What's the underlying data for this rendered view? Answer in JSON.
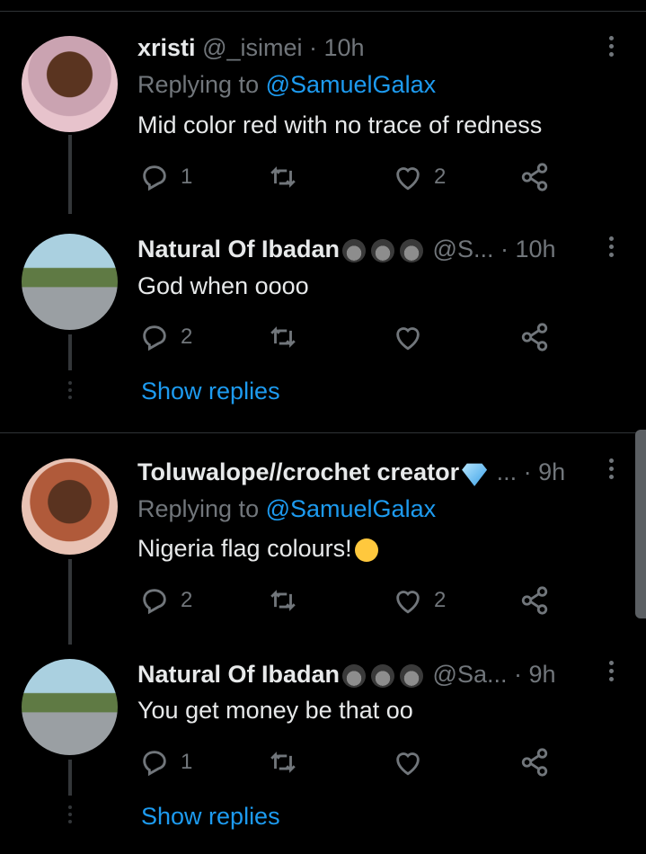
{
  "tweets": [
    {
      "name": "xristi",
      "handle": "@_isimei",
      "dot": " · ",
      "time": "10h",
      "replying_label": "Replying to ",
      "replying_mention": "@SamuelGalax",
      "text": "Mid color red with no trace of redness",
      "reply_count": "1",
      "retweet_count": "",
      "like_count": "2"
    },
    {
      "name": "Natural Of Ibadan",
      "handle": "@S...",
      "dot": " · ",
      "time": "10h",
      "text": "God when oooo",
      "reply_count": "2",
      "retweet_count": "",
      "like_count": "",
      "show_replies": "Show replies"
    },
    {
      "name": "Toluwalope//crochet creator",
      "handle": "...",
      "dot": " · ",
      "time": "9h",
      "replying_label": "Replying to ",
      "replying_mention": "@SamuelGalax",
      "text": "Nigeria flag colours!",
      "reply_count": "2",
      "retweet_count": "",
      "like_count": "2"
    },
    {
      "name": "Natural Of Ibadan",
      "handle": "@Sa...",
      "dot": " · ",
      "time": "9h",
      "text": "You get money be that oo",
      "reply_count": "1",
      "retweet_count": "",
      "like_count": "",
      "show_replies": "Show replies"
    }
  ],
  "icons": {
    "reply": "reply-icon",
    "retweet": "retweet-icon",
    "like": "heart-icon",
    "share": "share-icon",
    "more": "more-vertical-icon"
  },
  "colors": {
    "background": "#000000",
    "accent": "#1d9bf0",
    "muted": "#71767b",
    "text": "#e7e9ea"
  }
}
